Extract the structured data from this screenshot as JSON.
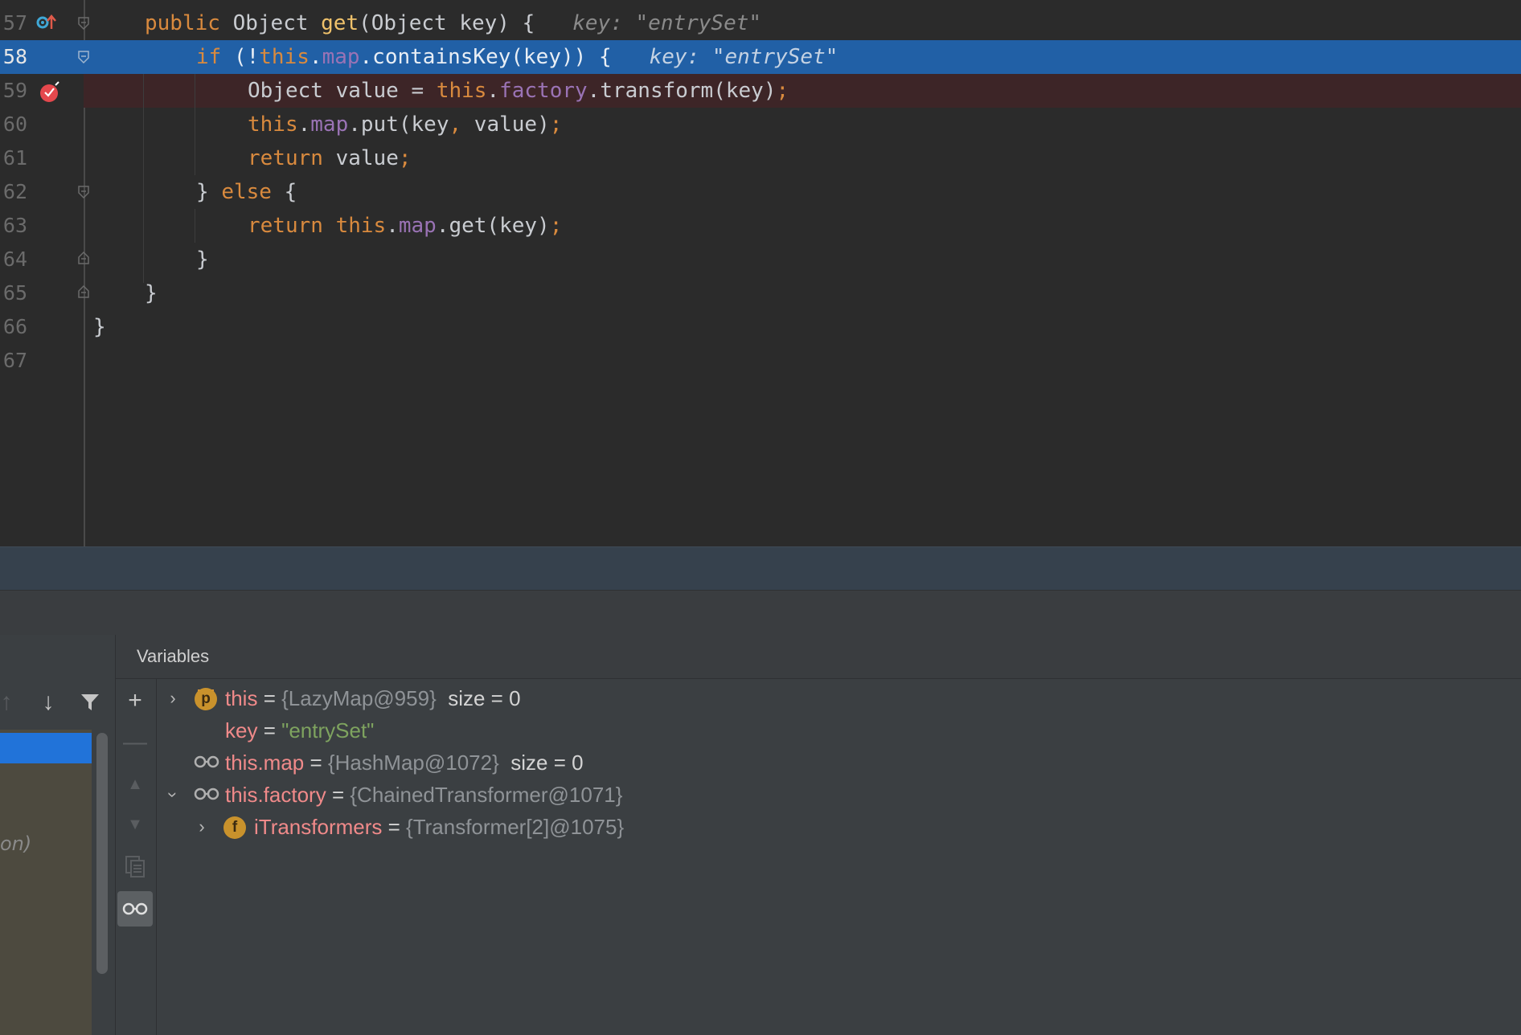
{
  "editor": {
    "lines": [
      {
        "num": "57",
        "segments": [
          [
            "kw",
            "public "
          ],
          [
            "",
            "Object "
          ],
          [
            "fn",
            "get"
          ],
          [
            "",
            "(Object key) {"
          ]
        ],
        "inlay": "key: \"entrySet\""
      },
      {
        "num": "58",
        "segments": [
          [
            "kw",
            "if "
          ],
          [
            "",
            "(!"
          ],
          [
            "kw",
            "this"
          ],
          [
            "",
            "."
          ],
          [
            "fld",
            "map"
          ],
          [
            "",
            ".containsKey(key)) {"
          ]
        ],
        "inlay": "key: \"entrySet\""
      },
      {
        "num": "59",
        "segments": [
          [
            "",
            "Object value = "
          ],
          [
            "kw",
            "this"
          ],
          [
            "",
            "."
          ],
          [
            "fld",
            "factory"
          ],
          [
            "",
            ".transform(key)"
          ],
          [
            "kw",
            ";"
          ]
        ],
        "inlay": ""
      },
      {
        "num": "60",
        "segments": [
          [
            "kw",
            "this"
          ],
          [
            "",
            "."
          ],
          [
            "fld",
            "map"
          ],
          [
            "",
            ".put(key"
          ],
          [
            "kw",
            ", "
          ],
          [
            "",
            "value)"
          ],
          [
            "kw",
            ";"
          ]
        ],
        "inlay": ""
      },
      {
        "num": "61",
        "segments": [
          [
            "kw",
            "return "
          ],
          [
            "",
            "value"
          ],
          [
            "kw",
            ";"
          ]
        ],
        "inlay": ""
      },
      {
        "num": "62",
        "segments": [
          [
            "",
            "} "
          ],
          [
            "kw",
            "else "
          ],
          [
            "",
            "{"
          ]
        ],
        "inlay": ""
      },
      {
        "num": "63",
        "segments": [
          [
            "kw",
            "return this"
          ],
          [
            "",
            "."
          ],
          [
            "fld",
            "map"
          ],
          [
            "",
            ".get(key)"
          ],
          [
            "kw",
            ";"
          ]
        ],
        "inlay": ""
      },
      {
        "num": "64",
        "segments": [
          [
            "",
            "}"
          ]
        ],
        "inlay": ""
      },
      {
        "num": "65",
        "segments": [
          [
            "",
            "}"
          ]
        ],
        "inlay": ""
      },
      {
        "num": "66",
        "segments": [
          [
            "",
            "}"
          ]
        ],
        "inlay": ""
      },
      {
        "num": "67",
        "segments": [],
        "inlay": ""
      }
    ]
  },
  "frames": {
    "partial_text": "on)"
  },
  "variables": {
    "title": "Variables",
    "rows": [
      {
        "name": "this",
        "eq": " = ",
        "value": "{LazyMap@959}",
        "extra": "  size = 0"
      },
      {
        "name": "key",
        "eq": " = ",
        "value": "\"entrySet\"",
        "extra": ""
      },
      {
        "name": "this.map",
        "eq": " = ",
        "value": "{HashMap@1072}",
        "extra": "  size = 0"
      },
      {
        "name": "this.factory",
        "eq": " = ",
        "value": "{ChainedTransformer@1071}",
        "extra": ""
      },
      {
        "name": "iTransformers",
        "eq": " = ",
        "value": "{Transformer[2]@1075}",
        "extra": ""
      }
    ],
    "badges": {
      "param": "p",
      "field": "f"
    }
  },
  "colors": {
    "current_line": "#2160a6",
    "breakpoint_line": "#3d2527",
    "keyword": "#d98a3e",
    "field": "#9a73b5",
    "var_name": "#f08a8a"
  }
}
